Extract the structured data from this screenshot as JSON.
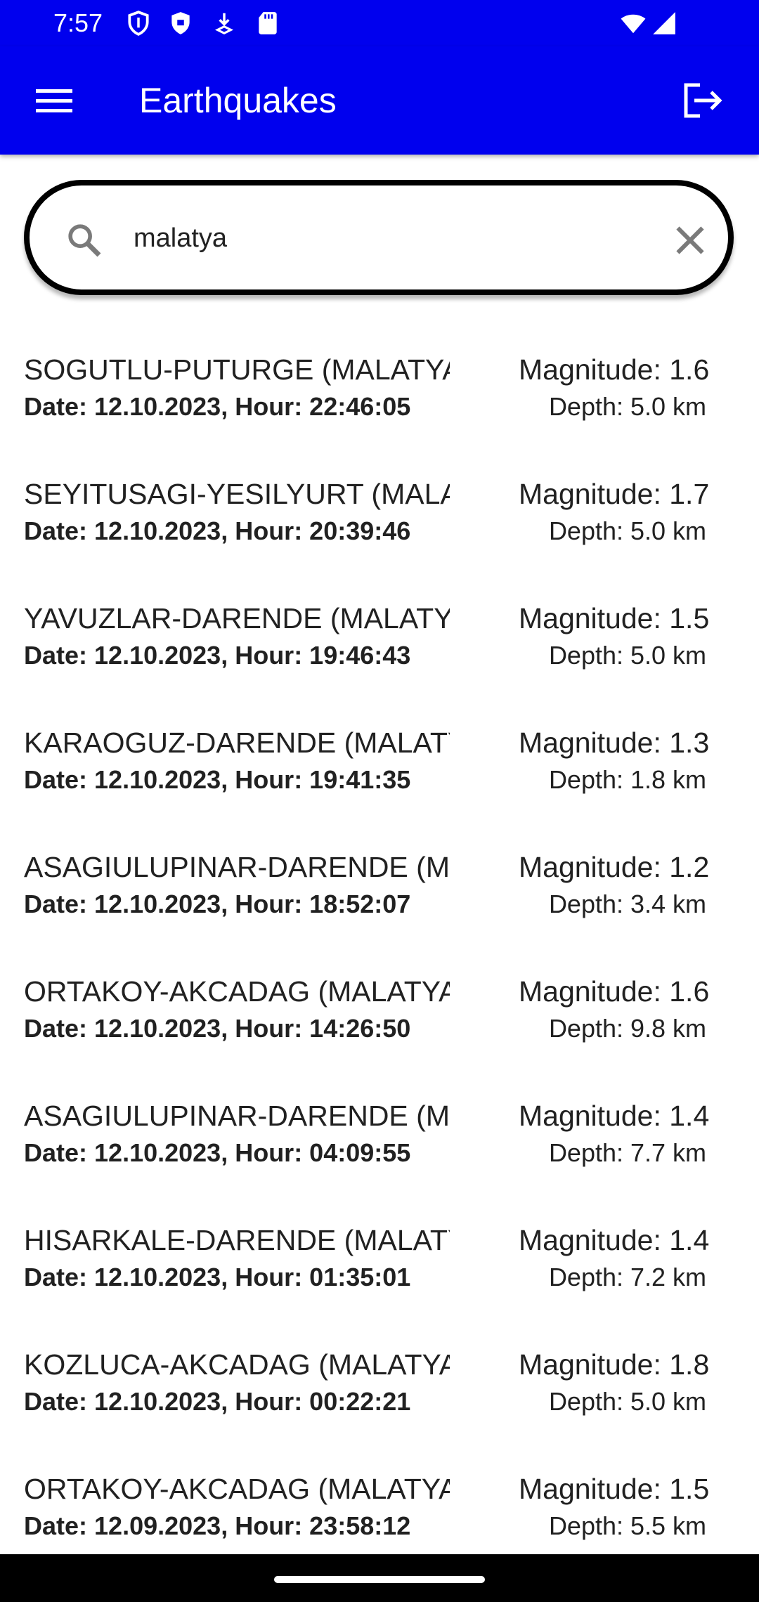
{
  "status_bar": {
    "time": "7:57",
    "icons": [
      "shield-outline-icon",
      "shield-filled-icon",
      "download-icon",
      "sd-card-icon",
      "wifi-icon",
      "signal-icon"
    ]
  },
  "app_bar": {
    "title": "Earthquakes",
    "background": "#0000ee",
    "menu_icon": "menu-icon",
    "logout_icon": "logout-icon"
  },
  "search": {
    "value": "malatya",
    "search_icon": "search-icon",
    "clear_icon": "clear-icon"
  },
  "earthquakes": [
    {
      "location": "SOGUTLU-PUTURGE (MALATYA)",
      "date": "Date: 12.10.2023, Hour: 22:46:05",
      "magnitude": "Magnitude: 1.6",
      "depth": "Depth: 5.0 km"
    },
    {
      "location": "SEYITUSAGI-YESILYURT (MALATYA)",
      "date": "Date: 12.10.2023, Hour: 20:39:46",
      "magnitude": "Magnitude: 1.7",
      "depth": "Depth: 5.0 km"
    },
    {
      "location": "YAVUZLAR-DARENDE (MALATYA)",
      "date": "Date: 12.10.2023, Hour: 19:46:43",
      "magnitude": "Magnitude: 1.5",
      "depth": "Depth: 5.0 km"
    },
    {
      "location": "KARAOGUZ-DARENDE (MALATYA)",
      "date": "Date: 12.10.2023, Hour: 19:41:35",
      "magnitude": "Magnitude: 1.3",
      "depth": "Depth: 1.8 km"
    },
    {
      "location": "ASAGIULUPINAR-DARENDE (MALATYA)",
      "date": "Date: 12.10.2023, Hour: 18:52:07",
      "magnitude": "Magnitude: 1.2",
      "depth": "Depth: 3.4 km"
    },
    {
      "location": "ORTAKOY-AKCADAG (MALATYA)",
      "date": "Date: 12.10.2023, Hour: 14:26:50",
      "magnitude": "Magnitude: 1.6",
      "depth": "Depth: 9.8 km"
    },
    {
      "location": "ASAGIULUPINAR-DARENDE (MALATYA)",
      "date": "Date: 12.10.2023, Hour: 04:09:55",
      "magnitude": "Magnitude: 1.4",
      "depth": "Depth: 7.7 km"
    },
    {
      "location": "HISARKALE-DARENDE (MALATYA)",
      "date": "Date: 12.10.2023, Hour: 01:35:01",
      "magnitude": "Magnitude: 1.4",
      "depth": "Depth: 7.2 km"
    },
    {
      "location": "KOZLUCA-AKCADAG (MALATYA)",
      "date": "Date: 12.10.2023, Hour: 00:22:21",
      "magnitude": "Magnitude: 1.8",
      "depth": "Depth: 5.0 km"
    },
    {
      "location": "ORTAKOY-AKCADAG (MALATYA)",
      "date": "Date: 12.09.2023, Hour: 23:58:12",
      "magnitude": "Magnitude: 1.5",
      "depth": "Depth: 5.5 km"
    }
  ]
}
